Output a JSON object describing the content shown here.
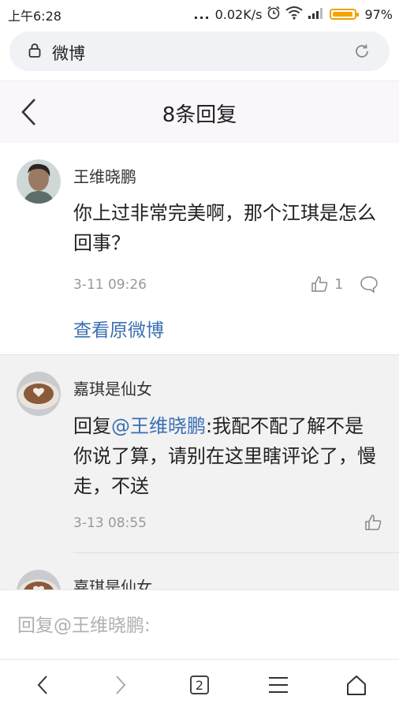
{
  "status": {
    "time": "上午6:28",
    "dots": "...",
    "speed": "0.02K/s",
    "battery": "97%"
  },
  "urlbar": {
    "site": "微博",
    "icons": [
      "lock-icon",
      "refresh-icon"
    ]
  },
  "header": {
    "title": "8条回复",
    "back_icon": "chevron-left-icon"
  },
  "main_comment": {
    "author": "王维晓鹏",
    "text": "你上过非常完美啊，那个江琪是怎么回事？",
    "time": "3-11 09:26",
    "likes": "1",
    "view_original": "查看原微博"
  },
  "replies": [
    {
      "author": "嘉琪是仙女",
      "reply_prefix": "回复",
      "mention": "@王维晓鹏",
      "text": ":我配不配了解不是你说了算，请别在这里瞎评论了，慢走，不送",
      "time": "3-13 08:55"
    },
    {
      "author": "嘉琪是仙女"
    }
  ],
  "reply_input": {
    "placeholder": "回复@王维晓鹏:"
  },
  "bottom_nav": {
    "tab_count": "2"
  },
  "colors": {
    "link": "#3b6fb2",
    "header_bg": "#fbf6fa",
    "reply_bg": "#f2f2f2",
    "battery": "#f5a300"
  }
}
